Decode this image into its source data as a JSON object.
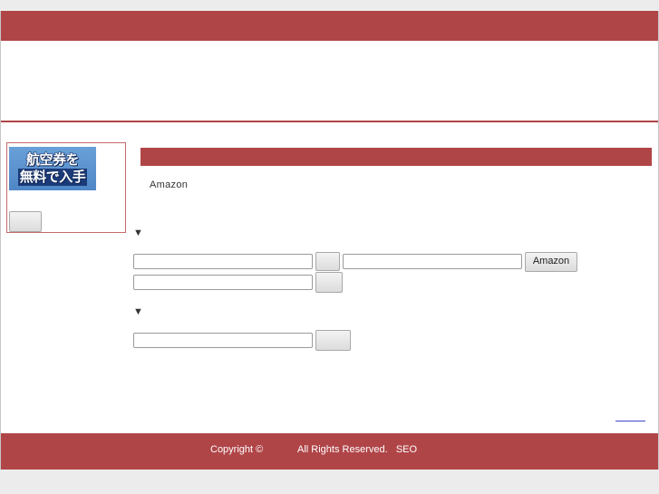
{
  "sidebar": {
    "banner_line1": "航空券を",
    "banner_line2": "無料で入手",
    "button_label": ""
  },
  "main": {
    "amazon_text": "Amazon",
    "triangle": "▼",
    "search1": {
      "value": "",
      "button_label": ""
    },
    "amazon_search": {
      "value": "",
      "button_label": "Amazon"
    },
    "search2": {
      "value": "",
      "button_label": ""
    },
    "search3": {
      "value": "",
      "button_label": ""
    }
  },
  "footer": {
    "copyright": "Copyright ©",
    "rights": "All Rights Reserved.   SEO"
  },
  "colors": {
    "brand": "#b04548",
    "background": "#ececec"
  }
}
